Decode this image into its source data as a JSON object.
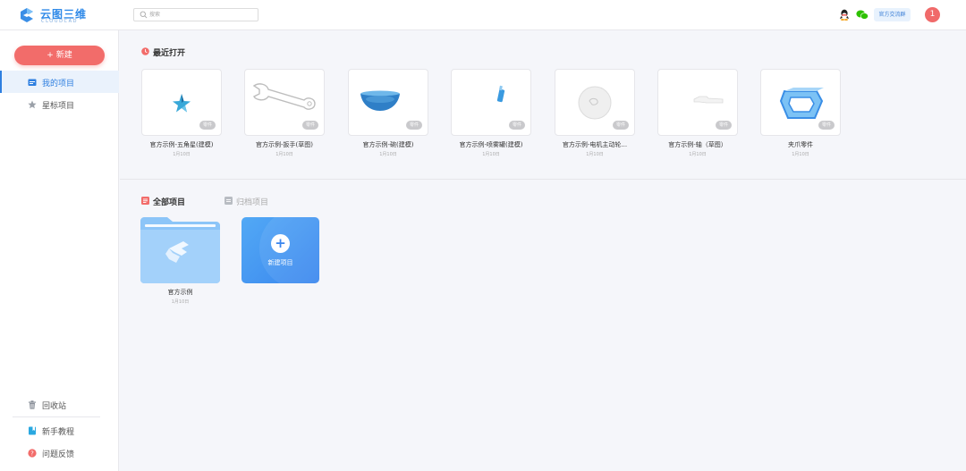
{
  "app": {
    "logo_title": "云图三维",
    "logo_subtitle": "CLOUDCAD"
  },
  "topbar": {
    "search_placeholder": "搜索",
    "group_label": "官方交流群",
    "avatar_initial": "1"
  },
  "sidebar": {
    "new_button": "+ 新建",
    "items": [
      {
        "label": "我的项目",
        "icon": "folder-icon",
        "active": true
      },
      {
        "label": "星标项目",
        "icon": "star-icon",
        "active": false
      }
    ],
    "bottom_items": [
      {
        "label": "回收站",
        "icon": "trash-icon"
      },
      {
        "label": "新手教程",
        "icon": "bookmark-icon"
      },
      {
        "label": "问题反馈",
        "icon": "help-icon"
      }
    ]
  },
  "recent": {
    "title": "最近打开",
    "badge": "零件",
    "cards": [
      {
        "name": "官方示例-五角星(建模)",
        "date": "1月10日",
        "thumb": "star-part"
      },
      {
        "name": "官方示例-扳手(草图)",
        "date": "1月10日",
        "thumb": "wrench-part"
      },
      {
        "name": "官方示例-碗(建模)",
        "date": "1月10日",
        "thumb": "bowl-part"
      },
      {
        "name": "官方示例-喷雾罐(建模)",
        "date": "1月10日",
        "thumb": "spray-can-part"
      },
      {
        "name": "官方示例-电机主动轮...",
        "date": "1月10日",
        "thumb": "wheel-part"
      },
      {
        "name": "官方示例-轴（草图）",
        "date": "1月10日",
        "thumb": "shaft-part"
      },
      {
        "name": "夹爪零件",
        "date": "1月10日",
        "thumb": "gripper-part"
      }
    ]
  },
  "projects": {
    "tab_all": "全部项目",
    "tab_archived": "归档项目",
    "folders": [
      {
        "name": "官方示例",
        "date": "1月10日"
      }
    ],
    "new_project_label": "新建项目"
  },
  "colors": {
    "accent": "#2e7fe0",
    "primary_red": "#f26c6a",
    "new_project_blue": "#3a86ee"
  }
}
